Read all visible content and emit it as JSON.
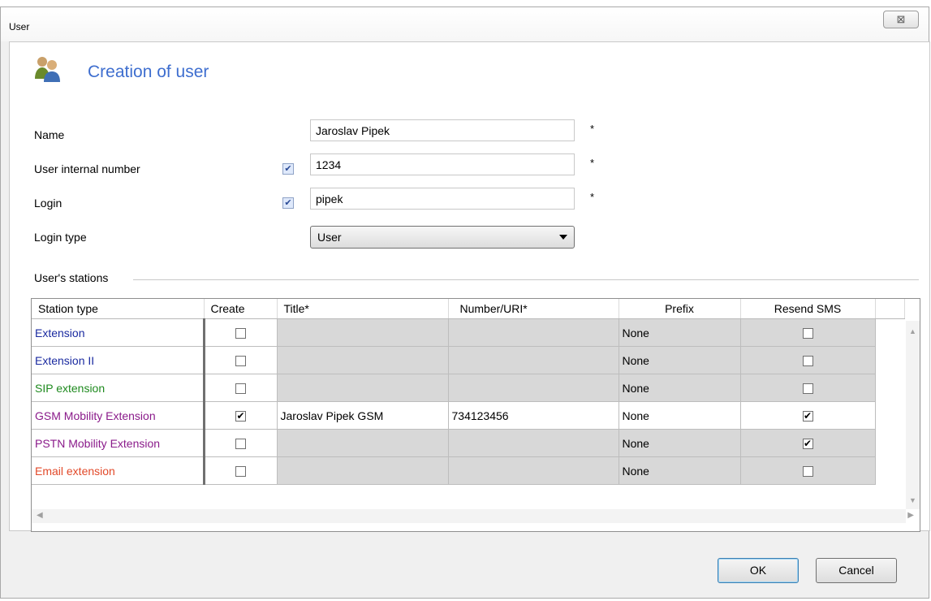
{
  "window": {
    "title": "User",
    "close_glyph": "⊠"
  },
  "header": {
    "icon": "users-icon",
    "title": "Creation of user"
  },
  "form": {
    "name_label": "Name",
    "name_value": "Jaroslav Pipek",
    "internal_number_label": "User internal number",
    "internal_number_checked": true,
    "internal_number_value": "1234",
    "login_label": "Login",
    "login_checked": true,
    "login_value": "pipek",
    "login_type_label": "Login type",
    "login_type_value": "User",
    "required_mark": "*"
  },
  "stations": {
    "group_label": "User's stations",
    "columns": [
      "Station type",
      "Create",
      "Title*",
      "Number/URI*",
      "Prefix",
      "Resend SMS"
    ],
    "rows": [
      {
        "type": "Extension",
        "color": "#1a2aa0",
        "create": false,
        "title": "",
        "number": "",
        "prefix": "None",
        "resend_sms": false,
        "gray": true
      },
      {
        "type": "Extension II",
        "color": "#1a2aa0",
        "create": false,
        "title": "",
        "number": "",
        "prefix": "None",
        "resend_sms": false,
        "gray": true
      },
      {
        "type": "SIP extension",
        "color": "#1e8a1e",
        "create": false,
        "title": "",
        "number": "",
        "prefix": "None",
        "resend_sms": false,
        "gray": true
      },
      {
        "type": "GSM Mobility Extension",
        "color": "#8a1a8a",
        "create": true,
        "title": "Jaroslav Pipek GSM",
        "number": "734123456",
        "prefix": "None",
        "resend_sms": true,
        "gray": false
      },
      {
        "type": "PSTN Mobility Extension",
        "color": "#8a1a8a",
        "create": false,
        "title": "",
        "number": "",
        "prefix": "None",
        "resend_sms": true,
        "gray": true
      },
      {
        "type": "Email extension",
        "color": "#e24a2a",
        "create": false,
        "title": "",
        "number": "",
        "prefix": "None",
        "resend_sms": false,
        "gray": true
      }
    ]
  },
  "buttons": {
    "ok": "OK",
    "cancel": "Cancel"
  }
}
